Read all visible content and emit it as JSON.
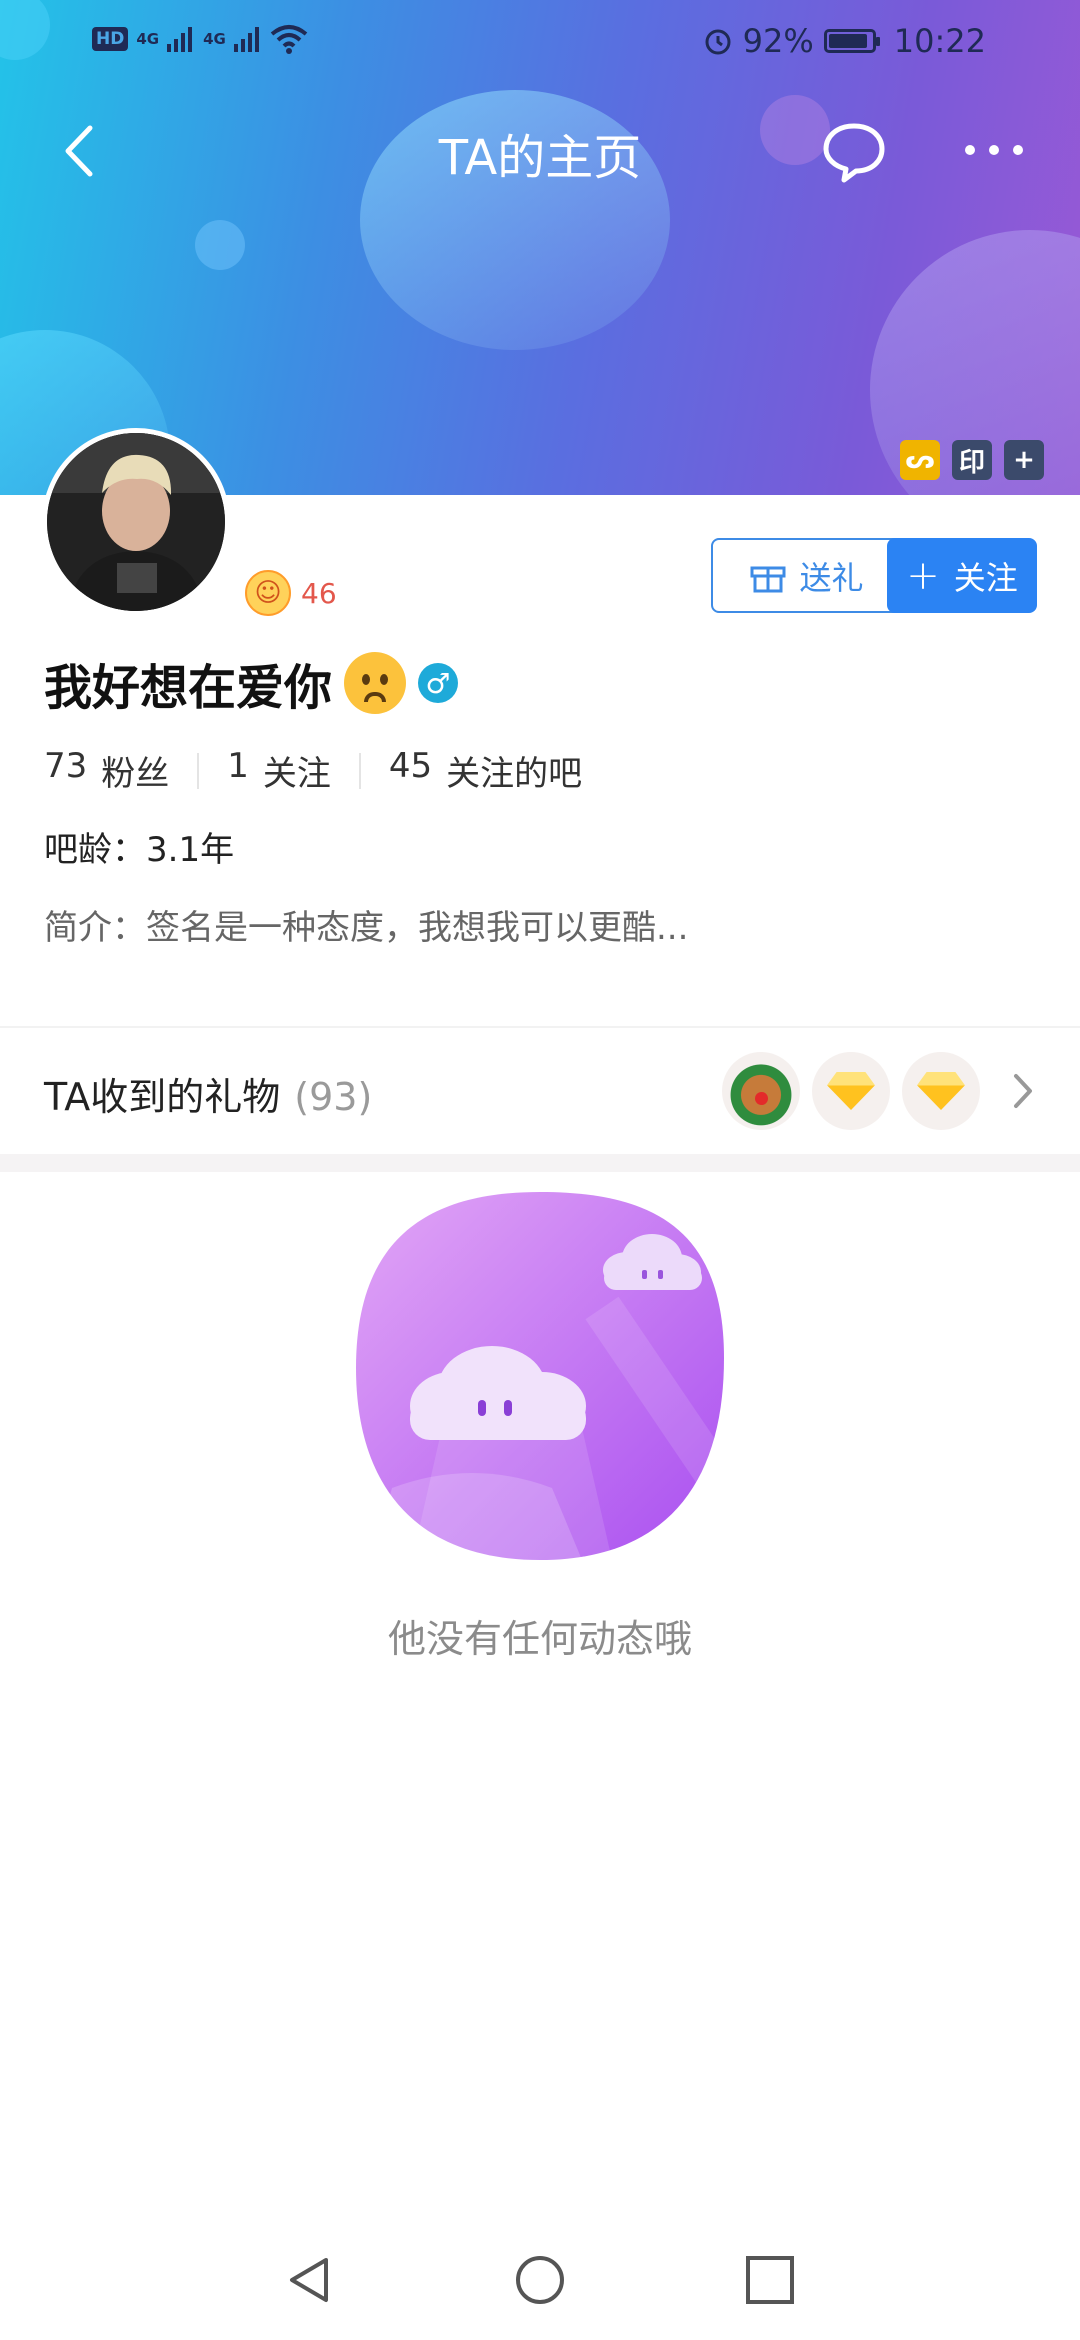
{
  "status_bar": {
    "network_left": "HD",
    "signal_1": "4G",
    "signal_2": "4G",
    "battery_percent": "92%",
    "battery_level": 0.92,
    "time": "10:22"
  },
  "nav": {
    "title": "TA的主页"
  },
  "banner_tags": [
    {
      "label": "ᔕ",
      "color": "#f0b400"
    },
    {
      "label": "印",
      "color": "#3b4a6b"
    },
    {
      "label": "+",
      "color": "#3b4a6b"
    }
  ],
  "profile": {
    "level": "46",
    "username": "我好想在爱你",
    "gender_symbol": "♂",
    "stats": [
      {
        "value": "73",
        "label": "粉丝"
      },
      {
        "value": "1",
        "label": "关注"
      },
      {
        "value": "45",
        "label": "关注的吧"
      }
    ],
    "age": "吧龄：3.1年",
    "bio": "简介：签名是一种态度，我想我可以更酷..."
  },
  "actions": {
    "gift_label": "送礼",
    "follow_label": "关注"
  },
  "gifts": {
    "title": "TA收到的礼物",
    "count": "(93)"
  },
  "empty_state": {
    "text": "他没有任何动态哦"
  },
  "colors": {
    "accent": "#2b83f3",
    "level_red": "#e3574b",
    "banner_start": "#23c3e8",
    "banner_end": "#9a59d6"
  }
}
